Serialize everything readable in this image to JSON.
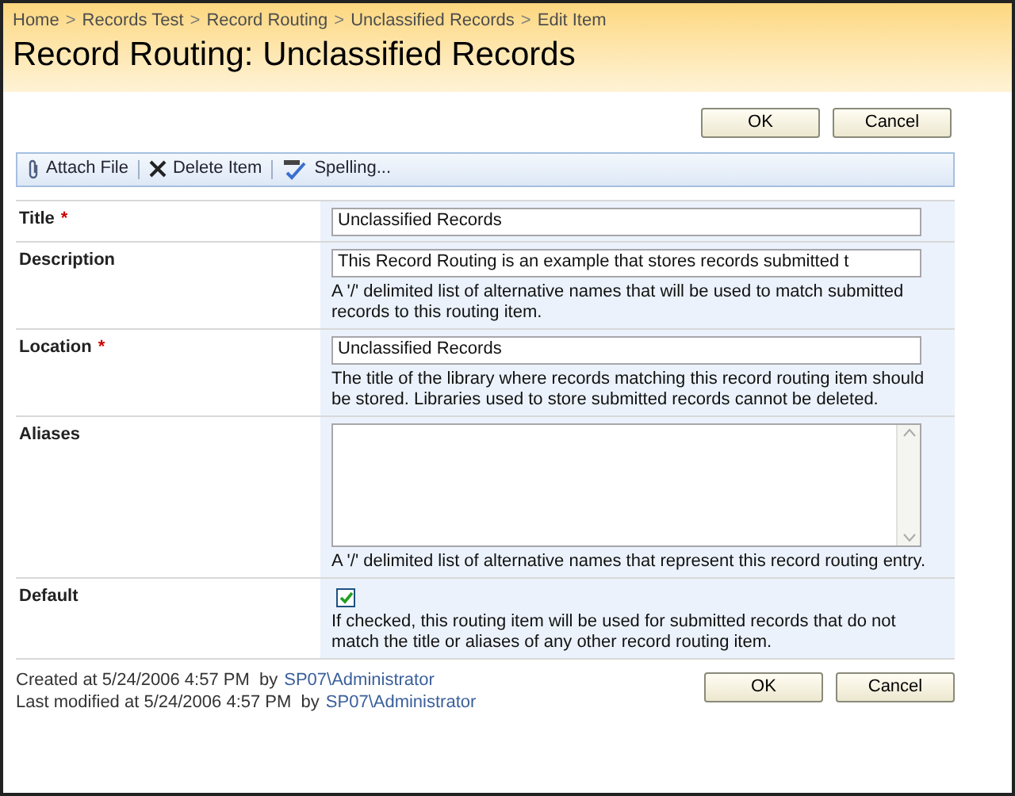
{
  "breadcrumb": [
    {
      "kind": "link",
      "text": "Home"
    },
    {
      "kind": "separator",
      "text": ">"
    },
    {
      "kind": "link",
      "text": "Records Test"
    },
    {
      "kind": "separator",
      "text": ">"
    },
    {
      "kind": "link",
      "text": "Record Routing"
    },
    {
      "kind": "separator",
      "text": ">"
    },
    {
      "kind": "link",
      "text": "Unclassified Records"
    },
    {
      "kind": "separator",
      "text": ">"
    },
    {
      "kind": "link",
      "text": "Edit Item"
    }
  ],
  "page_title": "Record Routing: Unclassified Records",
  "top_buttons": [
    "OK",
    "Cancel"
  ],
  "toolbar": [
    {
      "kind": "attach",
      "label": "Attach File"
    },
    {
      "kind": "delete",
      "label": "Delete Item"
    },
    {
      "kind": "spelling",
      "label": "Spelling..."
    }
  ],
  "fields": [
    {
      "kind": "text",
      "label": "Title",
      "required_mark": "*",
      "value": "Unclassified Records"
    },
    {
      "kind": "text",
      "label": "Description",
      "value": "This Record Routing is an example that stores records submitted t",
      "help": "A '/' delimited list of alternative names that will be used to match submitted records to this routing item."
    },
    {
      "kind": "text",
      "label": "Location",
      "required_mark": "*",
      "value": "Unclassified Records",
      "help": "The title of the library where records matching this record routing item should be stored. Libraries used to store submitted records cannot be deleted."
    },
    {
      "kind": "textarea",
      "label": "Aliases",
      "help": "A '/' delimited list of alternative names that represent this record routing entry."
    },
    {
      "kind": "checkbox",
      "label": "Default",
      "checked": true,
      "help": "If checked, this routing item will be used for submitted records that do not match the title or aliases of any other record routing item."
    }
  ],
  "footer": {
    "created": "Created at 5/24/2006 4:57 PM  by",
    "created_by": "SP07\\Administrator",
    "modified": "Last modified at 5/24/2006 4:57 PM  by",
    "modified_by": "SP07\\Administrator"
  },
  "bottom_buttons": [
    "OK",
    "Cancel"
  ]
}
